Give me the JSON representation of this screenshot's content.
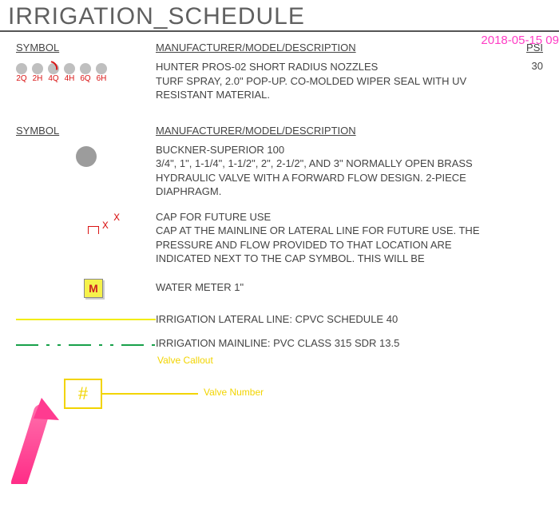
{
  "title": "IRRIGATION_SCHEDULE",
  "timestamp": "2018-05-15 09",
  "headers": {
    "symbol": "SYMBOL",
    "desc": "MANUFACTURER/MODEL/DESCRIPTION",
    "psi": "PSI"
  },
  "nozzles": {
    "labels": [
      "2Q",
      "2H",
      "4Q",
      "4H",
      "6Q",
      "6H"
    ],
    "desc": "HUNTER PROS-02 SHORT RADIUS NOZZLES\nTURF SPRAY, 2.0\" POP-UP.  CO-MOLDED WIPER SEAL WITH UV RESISTANT MATERIAL.",
    "psi": "30"
  },
  "valve": {
    "desc": "BUCKNER-SUPERIOR 100\n3/4\", 1\", 1-1/4\", 1-1/2\", 2\", 2-1/2\", AND 3\" NORMALLY OPEN BRASS HYDRAULIC VALVE WITH A FORWARD FLOW DESIGN. 2-PIECE DIAPHRAGM."
  },
  "cap": {
    "desc": "CAP FOR FUTURE USE\nCAP AT THE MAINLINE OR LATERAL LINE FOR FUTURE USE.  THE PRESSURE AND FLOW PROVIDED TO THAT LOCATION ARE INDICATED NEXT TO THE CAP SYMBOL. THIS WILL BE"
  },
  "meter": {
    "letter": "M",
    "desc": "WATER METER 1\""
  },
  "lateral": {
    "desc": "IRRIGATION LATERAL LINE: CPVC SCHEDULE 40"
  },
  "mainline": {
    "desc": "IRRIGATION MAINLINE: PVC CLASS 315 SDR 13.5"
  },
  "valve_callout": "Valve Callout",
  "valve_number_label": "Valve Number",
  "hash": "#"
}
